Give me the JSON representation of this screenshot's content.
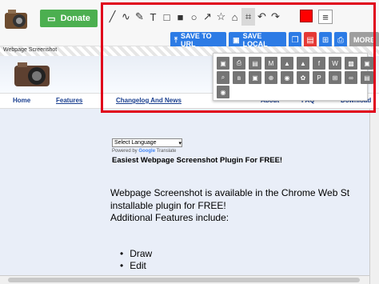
{
  "topbar": {
    "donate_label": "Donate"
  },
  "tools": [
    {
      "name": "line-tool-icon",
      "glyph": "╱"
    },
    {
      "name": "curve-tool-icon",
      "glyph": "∿"
    },
    {
      "name": "freehand-tool-icon",
      "glyph": "✎"
    },
    {
      "name": "text-tool-icon",
      "glyph": "T"
    },
    {
      "name": "rectangle-tool-icon",
      "glyph": "□"
    },
    {
      "name": "filled-rectangle-tool-icon",
      "glyph": "■"
    },
    {
      "name": "circle-tool-icon",
      "glyph": "○"
    },
    {
      "name": "arrow-tool-icon",
      "glyph": "↗"
    },
    {
      "name": "star-tool-icon",
      "glyph": "☆"
    },
    {
      "name": "home-tool-icon",
      "glyph": "⌂"
    },
    {
      "name": "crop-tool-icon",
      "glyph": "⌗"
    },
    {
      "name": "undo-icon",
      "glyph": "↶"
    },
    {
      "name": "redo-icon",
      "glyph": "↷"
    }
  ],
  "colors": {
    "accent": "#2c7be5",
    "selected_color": "#ff0000",
    "highlight_box": "#e0001b"
  },
  "actions": {
    "save_to_url_label": "SAVE TO URL",
    "save_local_label": "SAVE LOCAL",
    "more_label": "MORE"
  },
  "page": {
    "ws_label": "Webpage Screenshot",
    "nav": [
      "Home",
      "Features",
      "Changelog And News",
      "About",
      "FAQ",
      "Download"
    ],
    "language_select": "Select Language",
    "powered_by": "Powered by",
    "google": "Google",
    "translate": "Translate",
    "heading": "Easiest Webpage Screenshot Plugin For FREE!",
    "para1": "Webpage Screenshot is available in the Chrome Web St",
    "para2": "installable plugin for FREE!",
    "para3": "Additional Features include:",
    "bullets": [
      "Draw",
      "Edit"
    ]
  }
}
